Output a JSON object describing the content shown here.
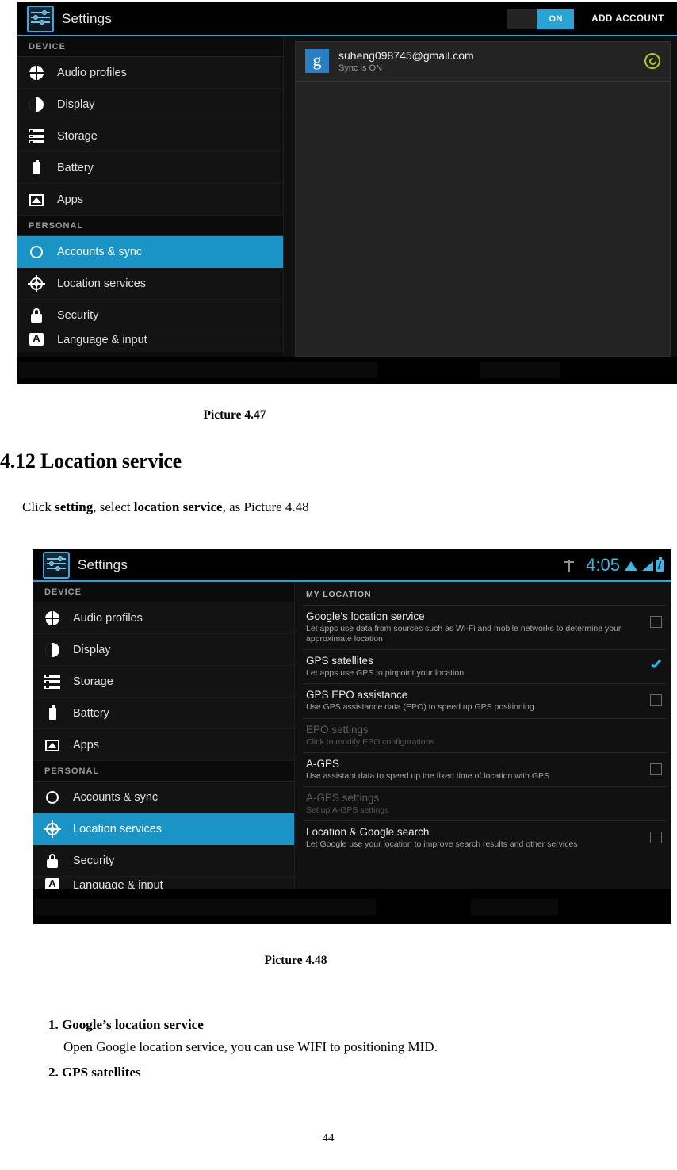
{
  "document": {
    "caption_447": "Picture 4.47",
    "caption_448": "Picture 4.48",
    "section_heading": "4.12 Location service",
    "intro_prefix": "Click ",
    "intro_b1": "setting",
    "intro_mid": ", select ",
    "intro_b2": "location service",
    "intro_suffix": ", as Picture 4.48",
    "page_number": "44",
    "steps": [
      {
        "title": "Google’s location service",
        "description": "Open Google location service, you can use WIFI to positioning MID."
      },
      {
        "title": "GPS satellites",
        "description": ""
      }
    ]
  },
  "screenshot1": {
    "app_title": "Settings",
    "toggle_label": "ON",
    "add_account_label": "ADD ACCOUNT",
    "sidebar": {
      "group_device": "DEVICE",
      "group_personal": "PERSONAL",
      "items": [
        {
          "label": "Audio profiles",
          "icon": "audio-profiles-icon"
        },
        {
          "label": "Display",
          "icon": "display-icon"
        },
        {
          "label": "Storage",
          "icon": "storage-icon"
        },
        {
          "label": "Battery",
          "icon": "battery-icon"
        },
        {
          "label": "Apps",
          "icon": "apps-icon"
        },
        {
          "label": "Accounts & sync",
          "icon": "sync-icon"
        },
        {
          "label": "Location services",
          "icon": "location-icon"
        },
        {
          "label": "Security",
          "icon": "lock-icon"
        },
        {
          "label": "Language & input",
          "icon": "language-icon"
        }
      ],
      "selected": "Accounts & sync"
    },
    "account": {
      "provider_glyph": "g",
      "email": "suheng098745@gmail.com",
      "status": "Sync is ON",
      "sync_icon": "sync-active-icon"
    },
    "colors": {
      "accent": "#1a93c6",
      "toggle_on": "#2aa3d4",
      "sync_green": "#a4cc1a"
    }
  },
  "screenshot2": {
    "app_title": "Settings",
    "statusbar": {
      "usb_icon": "usb-icon",
      "time": "4:05",
      "wifi_icon": "wifi-icon",
      "signal_icon": "signal-icon",
      "battery_icon": "battery-charging-icon"
    },
    "sidebar": {
      "group_device": "DEVICE",
      "group_personal": "PERSONAL",
      "items": [
        {
          "label": "Audio profiles",
          "icon": "audio-profiles-icon"
        },
        {
          "label": "Display",
          "icon": "display-icon"
        },
        {
          "label": "Storage",
          "icon": "storage-icon"
        },
        {
          "label": "Battery",
          "icon": "battery-icon"
        },
        {
          "label": "Apps",
          "icon": "apps-icon"
        },
        {
          "label": "Accounts & sync",
          "icon": "sync-icon"
        },
        {
          "label": "Location services",
          "icon": "location-icon"
        },
        {
          "label": "Security",
          "icon": "lock-icon"
        },
        {
          "label": "Language & input",
          "icon": "language-icon"
        }
      ],
      "selected": "Location services"
    },
    "location": {
      "section_header": "MY LOCATION",
      "rows": [
        {
          "title": "Google's location service",
          "desc": "Let apps use data from sources such as Wi-Fi and mobile networks to determine your approximate location",
          "checked": false,
          "enabled": true
        },
        {
          "title": "GPS satellites",
          "desc": "Let apps use GPS to pinpoint your location",
          "checked": true,
          "enabled": true
        },
        {
          "title": "GPS EPO assistance",
          "desc": "Use GPS assistance data (EPO) to speed up GPS positioning.",
          "checked": false,
          "enabled": true
        },
        {
          "title": "EPO settings",
          "desc": "Click to modify EPO configurations",
          "checked": null,
          "enabled": false
        },
        {
          "title": "A-GPS",
          "desc": "Use assistant data to speed up the fixed time of location with GPS",
          "checked": false,
          "enabled": true
        },
        {
          "title": "A-GPS settings",
          "desc": "Set up A-GPS settings",
          "checked": null,
          "enabled": false
        },
        {
          "title": "Location & Google search",
          "desc": "Let Google use your location to improve search results and other services",
          "checked": false,
          "enabled": true
        }
      ]
    },
    "colors": {
      "accent": "#1a93c6",
      "status_blue": "#3fb7e6"
    }
  }
}
